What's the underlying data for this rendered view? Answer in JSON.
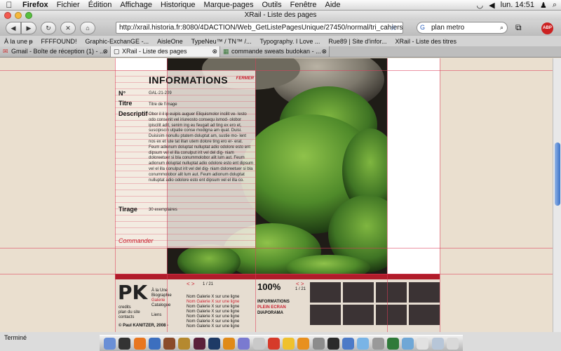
{
  "menubar": {
    "app": "Firefox",
    "items": [
      "Fichier",
      "Édition",
      "Affichage",
      "Historique",
      "Marque-pages",
      "Outils",
      "Fenêtre",
      "Aide"
    ],
    "clock": "lun. 14:51"
  },
  "window": {
    "title": "XRail - Liste des pages",
    "url": "http://xrail.historia.fr:8080/4DACTION/Web_GetListePagesUnique/27450/normal/tri_cahiers",
    "search_value": "plan metro"
  },
  "bookmarks": [
    "À la une ᵽ",
    "FFFFOUND!",
    "Graphic-ExchanGE -...",
    "AisleOne",
    "TypeNeu™ / TN™ /...",
    "Typography. I Love ...",
    "Rue89 | Site d'infor...",
    "XRail - Liste des titres"
  ],
  "tabs": [
    {
      "label": "Gmail - Boîte de réception (1) - ...",
      "active": false
    },
    {
      "label": "XRail - Liste des pages",
      "active": true
    },
    {
      "label": "commande sweats budokan - ...",
      "active": false
    }
  ],
  "info": {
    "title": "INFORMATIONS",
    "close": "FERMER",
    "n_label": "N°",
    "n_value": "GAL-21-209",
    "titre_label": "Titre",
    "titre_value": "Titre de l'image",
    "desc_label": "Descriptif",
    "desc_value": "Obor il il ip euipis auguer Eliquismolor incilit ve- lesto odo consenit vel iriureosto consequ ismod- olobor ipiscilit adit, senim ing eu feugait ad ting ex ero et, suscipiscin utpatie conse modigna am quat. Duisi. Duisisim nonullu ptatem doluptat am, sustie mo- lent nos ex et lute tat illan utem dolore ting ero er- erat. Feum adionum doluptat nulluptat adio odolore esto ent dipsum vel el illa conulput irit vel del dig- niam doloreetuer si bla conummolobor alit lum aut. Feum adionum doluptat nulluptat adio odolore esto ent dipsum vel el illa conulput irit vel del dig- niam doloreetuer si bla conummolobor alit lum aut. Feum adionum doluptat nulluptat adio odolore esto ent dipsum vel el illa co.",
    "tirage_label": "Tirage",
    "tirage_value": "30 exemplaires",
    "commander": "Commander"
  },
  "footer": {
    "logo": "PK",
    "links_left": [
      "credits",
      "plan du site",
      "contacts"
    ],
    "copyright": "© Paul KANITZER, 2008 -",
    "menu": [
      "À la Une",
      "Biographie",
      "Galerie",
      "Catalogue",
      "",
      "Liens"
    ],
    "pagination": "1 / 21",
    "gallery_lines": [
      "Nom Galerie X sur une ligne",
      "Nom Galerie X sur une ligne",
      "Nom Galerie X sur une ligne",
      "Nom Galerie X sur une ligne",
      "Nom Galerie X sur une ligne",
      "Nom Galerie X sur une ligne",
      "Nom Galerie X sur une ligne"
    ],
    "zoom": "100%",
    "zoom_pagination": "1 / 21",
    "view_options": [
      "INFORMATIONS",
      "PLEIN ECRAN",
      "DIAPORAMA"
    ]
  },
  "status": "Terminé"
}
